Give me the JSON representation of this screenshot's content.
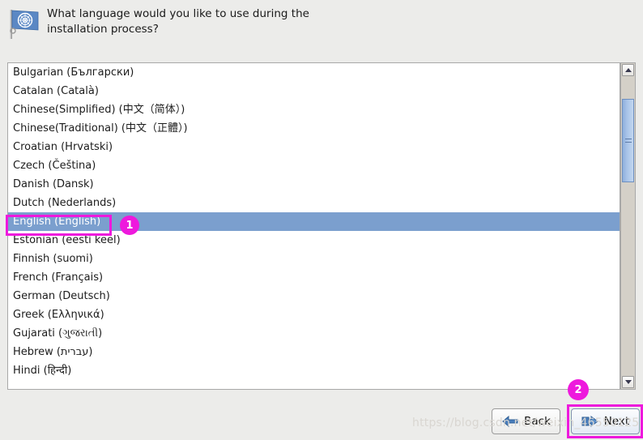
{
  "header": {
    "question_line1": "What language would you like to use during the",
    "question_line2": "installation process?",
    "icon": "un-flag-icon"
  },
  "language_list": {
    "selected": "English (English)",
    "items": [
      {
        "label": "Bulgarian (Български)",
        "selected": false
      },
      {
        "label": "Catalan (Català)",
        "selected": false
      },
      {
        "label": "Chinese(Simplified) (中文（简体）)",
        "selected": false
      },
      {
        "label": "Chinese(Traditional) (中文（正體）)",
        "selected": false
      },
      {
        "label": "Croatian (Hrvatski)",
        "selected": false
      },
      {
        "label": "Czech (Čeština)",
        "selected": false
      },
      {
        "label": "Danish (Dansk)",
        "selected": false
      },
      {
        "label": "Dutch (Nederlands)",
        "selected": false
      },
      {
        "label": "English (English)",
        "selected": true
      },
      {
        "label": "Estonian (eesti keel)",
        "selected": false
      },
      {
        "label": "Finnish (suomi)",
        "selected": false
      },
      {
        "label": "French (Français)",
        "selected": false
      },
      {
        "label": "German (Deutsch)",
        "selected": false
      },
      {
        "label": "Greek (Ελληνικά)",
        "selected": false
      },
      {
        "label": "Gujarati (ગુજરાતી)",
        "selected": false
      },
      {
        "label": "Hebrew (עברית)",
        "selected": false
      },
      {
        "label": "Hindi (हिन्दी)",
        "selected": false
      }
    ]
  },
  "scrollbar": {
    "up_arrow": "scroll-up-icon",
    "down_arrow": "scroll-down-icon",
    "thumb": "scrollbar-thumb"
  },
  "buttons": {
    "back_label": "Back",
    "next_label": "Next",
    "back_icon": "arrow-left-icon",
    "next_icon": "arrow-right-icon"
  },
  "annotations": {
    "badge_1": "1",
    "badge_2": "2",
    "highlight_color": "#ee19dd"
  },
  "watermark": {
    "text": "https://blog.csdn.net/weixin_46550125"
  },
  "colors": {
    "selection_blue": "#7b9fce",
    "window_bg": "#ececea",
    "list_bg": "#ffffff",
    "annotation_magenta": "#ee19dd"
  }
}
